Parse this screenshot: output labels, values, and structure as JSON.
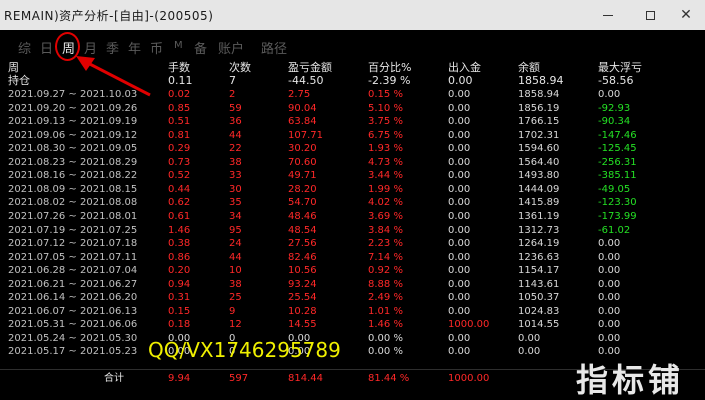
{
  "window": {
    "title": "REMAIN)资产分析-[自由]-(200505)",
    "minimize": "—",
    "maximize": "□",
    "close": "✕"
  },
  "tabs": [
    {
      "label": "综"
    },
    {
      "label": "日"
    },
    {
      "label": "周"
    },
    {
      "label": "月"
    },
    {
      "label": "季"
    },
    {
      "label": "年"
    },
    {
      "label": "币"
    },
    {
      "label": "M"
    },
    {
      "label": "备"
    },
    {
      "label": "账户"
    },
    {
      "label": "路径"
    }
  ],
  "table": {
    "headers": [
      "周",
      "手数",
      "次数",
      "盈亏金额",
      "百分比%",
      "出入金",
      "余额",
      "最大浮亏"
    ],
    "holding": {
      "label": "持仓",
      "lots": "0.11",
      "count": "7",
      "pnl": "-44.50",
      "pct": "-2.39 %",
      "io": "0.00",
      "balance": "1858.94",
      "max_dd": "-58.56"
    },
    "rows": [
      {
        "week": "2021.09.27 ~ 2021.10.03",
        "lots": "0.02",
        "count": "2",
        "pnl": "2.75",
        "pct": "0.15 %",
        "io": "0.00",
        "balance": "1858.94",
        "max_dd": "0.00"
      },
      {
        "week": "2021.09.20 ~ 2021.09.26",
        "lots": "0.85",
        "count": "59",
        "pnl": "90.04",
        "pct": "5.10 %",
        "io": "0.00",
        "balance": "1856.19",
        "max_dd": "-92.93"
      },
      {
        "week": "2021.09.13 ~ 2021.09.19",
        "lots": "0.51",
        "count": "36",
        "pnl": "63.84",
        "pct": "3.75 %",
        "io": "0.00",
        "balance": "1766.15",
        "max_dd": "-90.34"
      },
      {
        "week": "2021.09.06 ~ 2021.09.12",
        "lots": "0.81",
        "count": "44",
        "pnl": "107.71",
        "pct": "6.75 %",
        "io": "0.00",
        "balance": "1702.31",
        "max_dd": "-147.46"
      },
      {
        "week": "2021.08.30 ~ 2021.09.05",
        "lots": "0.29",
        "count": "22",
        "pnl": "30.20",
        "pct": "1.93 %",
        "io": "0.00",
        "balance": "1594.60",
        "max_dd": "-125.45"
      },
      {
        "week": "2021.08.23 ~ 2021.08.29",
        "lots": "0.73",
        "count": "38",
        "pnl": "70.60",
        "pct": "4.73 %",
        "io": "0.00",
        "balance": "1564.40",
        "max_dd": "-256.31"
      },
      {
        "week": "2021.08.16 ~ 2021.08.22",
        "lots": "0.52",
        "count": "33",
        "pnl": "49.71",
        "pct": "3.44 %",
        "io": "0.00",
        "balance": "1493.80",
        "max_dd": "-385.11"
      },
      {
        "week": "2021.08.09 ~ 2021.08.15",
        "lots": "0.44",
        "count": "30",
        "pnl": "28.20",
        "pct": "1.99 %",
        "io": "0.00",
        "balance": "1444.09",
        "max_dd": "-49.05"
      },
      {
        "week": "2021.08.02 ~ 2021.08.08",
        "lots": "0.62",
        "count": "35",
        "pnl": "54.70",
        "pct": "4.02 %",
        "io": "0.00",
        "balance": "1415.89",
        "max_dd": "-123.30"
      },
      {
        "week": "2021.07.26 ~ 2021.08.01",
        "lots": "0.61",
        "count": "34",
        "pnl": "48.46",
        "pct": "3.69 %",
        "io": "0.00",
        "balance": "1361.19",
        "max_dd": "-173.99"
      },
      {
        "week": "2021.07.19 ~ 2021.07.25",
        "lots": "1.46",
        "count": "95",
        "pnl": "48.54",
        "pct": "3.84 %",
        "io": "0.00",
        "balance": "1312.73",
        "max_dd": "-61.02"
      },
      {
        "week": "2021.07.12 ~ 2021.07.18",
        "lots": "0.38",
        "count": "24",
        "pnl": "27.56",
        "pct": "2.23 %",
        "io": "0.00",
        "balance": "1264.19",
        "max_dd": "0.00"
      },
      {
        "week": "2021.07.05 ~ 2021.07.11",
        "lots": "0.86",
        "count": "44",
        "pnl": "82.46",
        "pct": "7.14 %",
        "io": "0.00",
        "balance": "1236.63",
        "max_dd": "0.00"
      },
      {
        "week": "2021.06.28 ~ 2021.07.04",
        "lots": "0.20",
        "count": "10",
        "pnl": "10.56",
        "pct": "0.92 %",
        "io": "0.00",
        "balance": "1154.17",
        "max_dd": "0.00"
      },
      {
        "week": "2021.06.21 ~ 2021.06.27",
        "lots": "0.94",
        "count": "38",
        "pnl": "93.24",
        "pct": "8.88 %",
        "io": "0.00",
        "balance": "1143.61",
        "max_dd": "0.00"
      },
      {
        "week": "2021.06.14 ~ 2021.06.20",
        "lots": "0.31",
        "count": "25",
        "pnl": "25.54",
        "pct": "2.49 %",
        "io": "0.00",
        "balance": "1050.37",
        "max_dd": "0.00"
      },
      {
        "week": "2021.06.07 ~ 2021.06.13",
        "lots": "0.15",
        "count": "9",
        "pnl": "10.28",
        "pct": "1.01 %",
        "io": "0.00",
        "balance": "1024.83",
        "max_dd": "0.00"
      },
      {
        "week": "2021.05.31 ~ 2021.06.06",
        "lots": "0.18",
        "count": "12",
        "pnl": "14.55",
        "pct": "1.46 %",
        "io": "1000.00",
        "balance": "1014.55",
        "max_dd": "0.00"
      },
      {
        "week": "2021.05.24 ~ 2021.05.30",
        "lots": "0.00",
        "count": "0",
        "pnl": "0.00",
        "pct": "0.00 %",
        "io": "0.00",
        "balance": "0.00",
        "max_dd": "0.00"
      },
      {
        "week": "2021.05.17 ~ 2021.05.23",
        "lots": "0.00",
        "count": "0",
        "pnl": "0.00",
        "pct": "0.00 %",
        "io": "0.00",
        "balance": "0.00",
        "max_dd": "0.00"
      }
    ],
    "total": {
      "label": "合计",
      "lots": "9.94",
      "count": "597",
      "pnl": "814.44",
      "pct": "81.44 %",
      "io": "1000.00"
    }
  },
  "watermark": "QQ/VX1746295789",
  "logo": "指标铺",
  "colors": {
    "positive": "#ff2828",
    "negative": "#24e024",
    "annotation": "#e00000",
    "watermark": "#f0f000"
  }
}
